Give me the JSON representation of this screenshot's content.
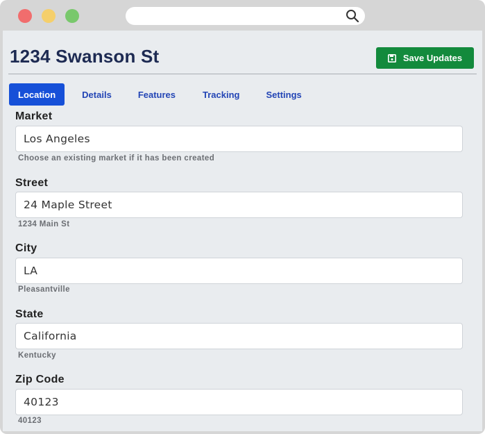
{
  "page": {
    "title": "1234 Swanson St",
    "save_label": "Save Updates"
  },
  "tabs": [
    {
      "label": "Location",
      "active": true
    },
    {
      "label": "Details",
      "active": false
    },
    {
      "label": "Features",
      "active": false
    },
    {
      "label": "Tracking",
      "active": false
    },
    {
      "label": "Settings",
      "active": false
    }
  ],
  "fields": {
    "market": {
      "label": "Market",
      "value": "Los Angeles",
      "help": "Choose an existing market if it has been created"
    },
    "street": {
      "label": "Street",
      "value": "24 Maple Street",
      "help": "1234 Main St"
    },
    "city": {
      "label": "City",
      "value": "LA",
      "help": "Pleasantville"
    },
    "state": {
      "label": "State",
      "value": "California",
      "help": "Kentucky"
    },
    "zip": {
      "label": "Zip Code",
      "value": "40123",
      "help": "40123"
    }
  },
  "icons": {
    "browser_search": "search-icon",
    "save": "floppy-disk-icon"
  },
  "colors": {
    "title": "#1d2a52",
    "save_button": "#138a3c",
    "active_tab": "#1650d8",
    "tab_text": "#2345b5"
  }
}
